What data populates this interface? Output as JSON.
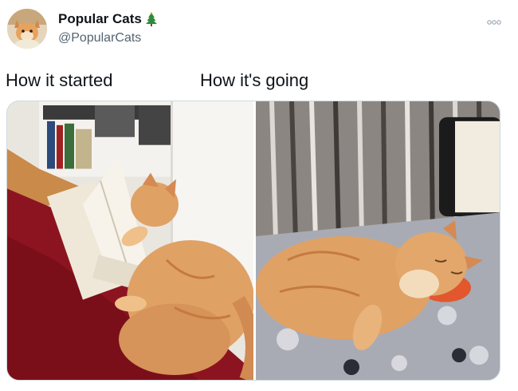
{
  "author": {
    "display_name": "Popular Cats",
    "handle": "@PopularCats",
    "badge_icon": "christmas-tree-icon",
    "avatar_icon": "cat-avatar"
  },
  "menu": {
    "icon": "more-options-icon"
  },
  "captions": {
    "left": "How it started",
    "right": "How it's going"
  },
  "media": {
    "left_photo": "orange cat reading a book on red rug",
    "right_photo": "orange cat sleeping on couch"
  },
  "colors": {
    "text": "#0f1419",
    "secondary_text": "#536471",
    "rug": "#8c1420",
    "cat": "#e0a165",
    "floor": "#c98a4a"
  }
}
